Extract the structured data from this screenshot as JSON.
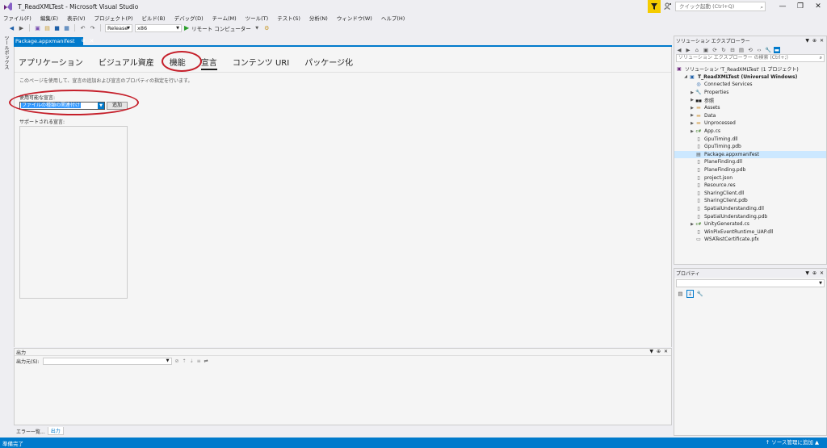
{
  "window": {
    "title": "T_ReadXMLTest - Microsoft Visual Studio",
    "quick_launch_placeholder": "クイック起動 (Ctrl+Q)",
    "minimize": "—",
    "restore": "❐",
    "close": "✕"
  },
  "menu": [
    "ファイル(F)",
    "編集(E)",
    "表示(V)",
    "プロジェクト(P)",
    "ビルド(B)",
    "デバッグ(D)",
    "チーム(M)",
    "ツール(T)",
    "テスト(S)",
    "分析(N)",
    "ウィンドウ(W)",
    "ヘルプ(H)"
  ],
  "toolbar": {
    "configuration": "Release",
    "platform": "x86",
    "run_target": "リモート コンピューター"
  },
  "toolbox_label": "ツールボックス",
  "document_tab": {
    "label": "Package.appxmanifest",
    "pin": "⊕",
    "close": "✕"
  },
  "manifest": {
    "tabs": [
      "アプリケーション",
      "ビジュアル資産",
      "機能",
      "宣言",
      "コンテンツ URI",
      "パッケージ化"
    ],
    "active_tab_index": 3,
    "description": "このページを使用して、宣言の追加および宣言のプロパティの指定を行います。",
    "available_label": "使用可能な宣言:",
    "selected_declaration": "ファイルの種類の関連付け",
    "add_button": "追加",
    "supported_label": "サポートされる宣言:"
  },
  "output": {
    "title": "出力",
    "source_label": "出力元(S):",
    "source_value": ""
  },
  "bottom_tabs": [
    "エラー一覧...",
    "出力"
  ],
  "solution_explorer": {
    "title": "ソリューション エクスプローラー",
    "search_placeholder": "ソリューション エクスプローラー の検索 (Ctrl+;)",
    "solution": "ソリューション 'T_ReadXMLTest' (1 プロジェクト)",
    "project": "T_ReadXMLTest (Universal Windows)",
    "items": [
      {
        "label": "Connected Services",
        "icon": "globe-icon",
        "expand": ""
      },
      {
        "label": "Properties",
        "icon": "wrench-icon",
        "expand": "▶"
      },
      {
        "label": "参照",
        "icon": "references-icon",
        "expand": "▶"
      },
      {
        "label": "Assets",
        "icon": "folder-icon",
        "expand": "▶"
      },
      {
        "label": "Data",
        "icon": "folder-icon",
        "expand": "▶"
      },
      {
        "label": "Unprocessed",
        "icon": "folder-icon",
        "expand": "▶"
      },
      {
        "label": "App.cs",
        "icon": "csharp-icon",
        "expand": "▶"
      },
      {
        "label": "GpuTiming.dll",
        "icon": "file-icon",
        "expand": ""
      },
      {
        "label": "GpuTiming.pdb",
        "icon": "file-icon",
        "expand": ""
      },
      {
        "label": "Package.appxmanifest",
        "icon": "manifest-icon",
        "expand": "",
        "selected": true
      },
      {
        "label": "PlaneFinding.dll",
        "icon": "file-icon",
        "expand": ""
      },
      {
        "label": "PlaneFinding.pdb",
        "icon": "file-icon",
        "expand": ""
      },
      {
        "label": "project.json",
        "icon": "file-icon",
        "expand": ""
      },
      {
        "label": "Resource.res",
        "icon": "file-icon",
        "expand": ""
      },
      {
        "label": "SharingClient.dll",
        "icon": "file-icon",
        "expand": ""
      },
      {
        "label": "SharingClient.pdb",
        "icon": "file-icon",
        "expand": ""
      },
      {
        "label": "SpatialUnderstanding.dll",
        "icon": "file-icon",
        "expand": ""
      },
      {
        "label": "SpatialUnderstanding.pdb",
        "icon": "file-icon",
        "expand": ""
      },
      {
        "label": "UnityGenerated.cs",
        "icon": "csharp-icon",
        "expand": "▶"
      },
      {
        "label": "WinPixEventRuntime_UAP.dll",
        "icon": "file-icon",
        "expand": ""
      },
      {
        "label": "WSATestCertificate.pfx",
        "icon": "certificate-icon",
        "expand": ""
      }
    ]
  },
  "properties": {
    "title": "プロパティ"
  },
  "status": {
    "ready": "準備完了",
    "source_control": "↑ ソース管理に追加 ▲"
  },
  "colors": {
    "accent": "#007acc",
    "annotation": "#c51f2a",
    "selection": "#3399ff"
  }
}
